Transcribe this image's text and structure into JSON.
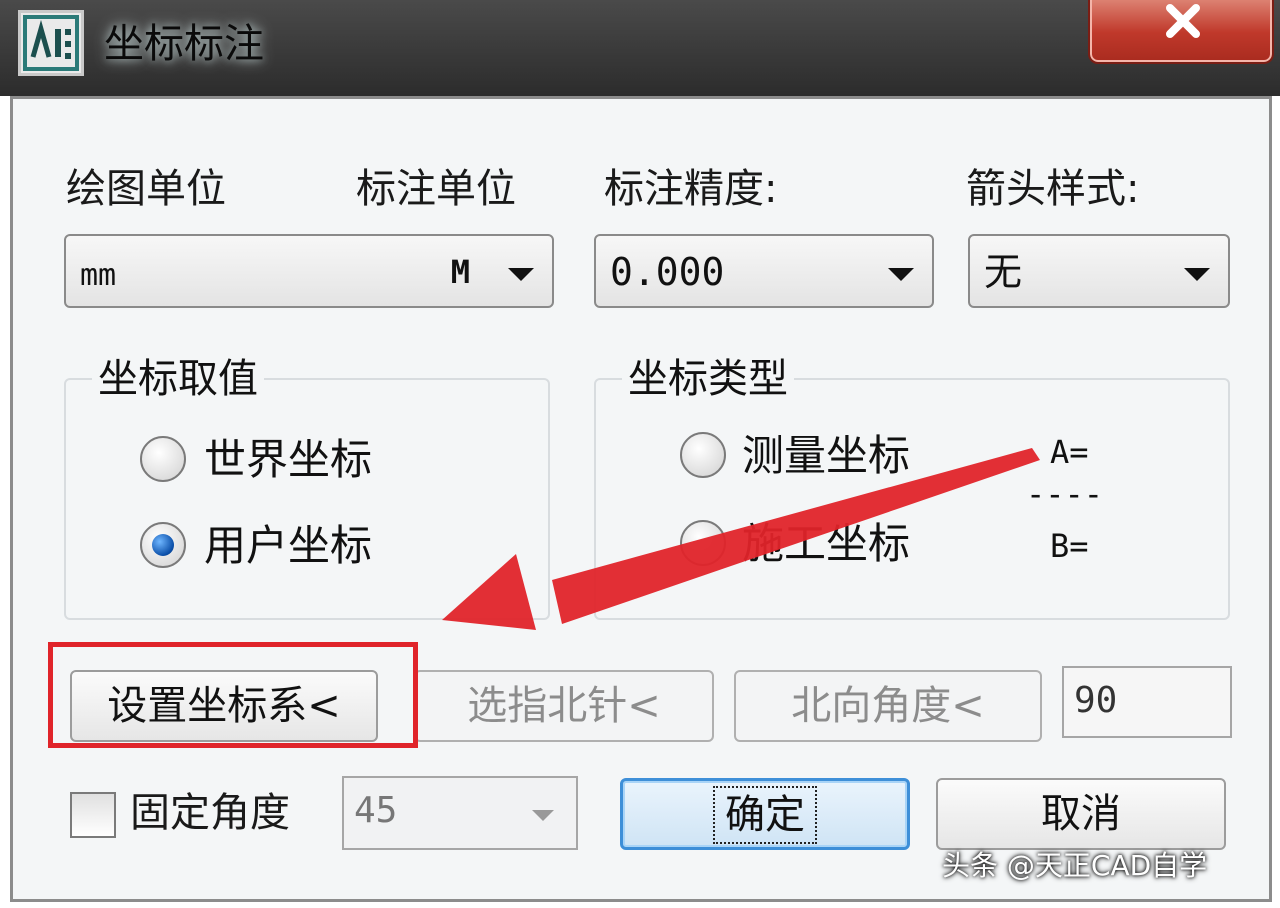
{
  "window": {
    "title": "坐标标注"
  },
  "units": {
    "drawing_unit_label": "绘图单位",
    "annotation_unit_label": "标注单位",
    "unit_combo": {
      "drawing_value": "mm",
      "annotation_value": "M"
    }
  },
  "precision": {
    "label": "标注精度:",
    "value": "0.000"
  },
  "arrow_style": {
    "label": "箭头样式:",
    "value": "无"
  },
  "coord_value_group": {
    "title": "坐标取值",
    "options": [
      {
        "label": "世界坐标",
        "checked": false
      },
      {
        "label": "用户坐标",
        "checked": true
      }
    ]
  },
  "coord_type_group": {
    "title": "坐标类型",
    "options": [
      {
        "label": "测量坐标",
        "checked": false
      },
      {
        "label": "施工坐标",
        "checked": false
      }
    ],
    "side_a": "A=",
    "side_sep": "----",
    "side_b": "B="
  },
  "actions": {
    "set_coord_system": "设置坐标系<",
    "pick_north_arrow": "选指北针<",
    "north_angle": "北向角度<",
    "north_angle_value": "90"
  },
  "fixed_angle": {
    "label": "固定角度",
    "value": "45",
    "checked": false
  },
  "buttons": {
    "ok": "确定",
    "cancel": "取消"
  },
  "watermark": "头条 @天正CAD自学",
  "colors": {
    "highlight": "#e0242a",
    "close": "#c0392b"
  }
}
